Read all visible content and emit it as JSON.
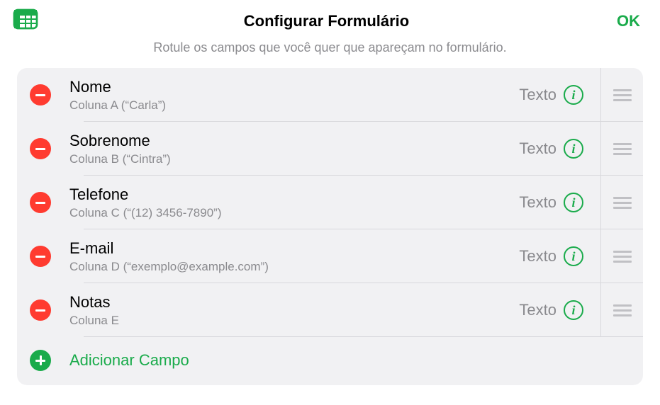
{
  "header": {
    "title": "Configurar Formulário",
    "ok_label": "OK"
  },
  "subtitle": "Rotule os campos que você quer que apareçam no formulário.",
  "fields": [
    {
      "label": "Nome",
      "sub": "Coluna A (“Carla”)",
      "type": "Texto"
    },
    {
      "label": "Sobrenome",
      "sub": "Coluna B (“Cintra”)",
      "type": "Texto"
    },
    {
      "label": "Telefone",
      "sub": "Coluna C (“(12) 3456-7890”)",
      "type": "Texto"
    },
    {
      "label": "E-mail",
      "sub": "Coluna D (“exemplo@example.com”)",
      "type": "Texto"
    },
    {
      "label": "Notas",
      "sub": "Coluna E",
      "type": "Texto"
    }
  ],
  "add_field_label": "Adicionar Campo"
}
